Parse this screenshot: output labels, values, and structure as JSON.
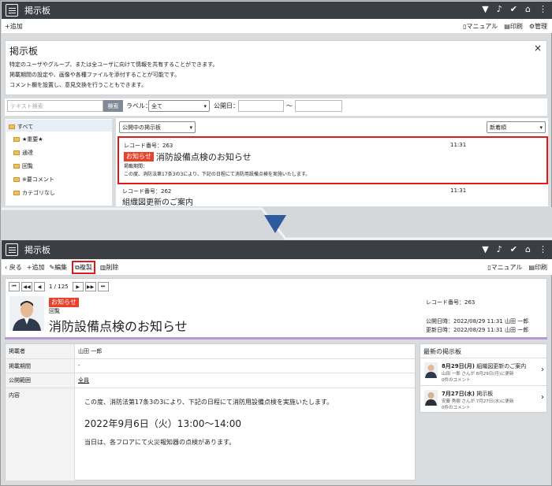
{
  "top": {
    "title": "掲示板",
    "add": "+追加",
    "manual": "マニュアル",
    "print": "印刷",
    "admin": "管理",
    "close": "×",
    "panel_title": "掲示板",
    "desc1": "特定のユーザやグループ、または全ユーザに向けて情報を共有することができます。",
    "desc2": "掲載期間の設定や、画像や各種ファイルを添付することが可能です。",
    "desc3": "コメント欄を設置し、意見交換を行うこともできます。",
    "search_placeholder": "テキスト検索",
    "search_btn": "検索",
    "label_label": "ラベル：",
    "label_value": "全て",
    "pubdate_label": "公開日：",
    "tilde": "～",
    "folders": [
      "すべて",
      "★重要★",
      "通達",
      "回覧",
      "※要コメント",
      "カテゴリなし"
    ],
    "filter": "公開中の掲示板",
    "sort": "新着順",
    "post1": {
      "number": "レコード番号：263",
      "time": "11:31",
      "badge": "お知らせ",
      "title": "消防設備点検のお知らせ",
      "period": "掲載期間：",
      "body": "この度、消防法第17条3の3により、下記の日程にて消防用設備点検を実施いたします。"
    },
    "post2": {
      "number": "レコード番号：262",
      "time": "11:31",
      "title": "組織図更新のご案内"
    }
  },
  "bottom": {
    "title": "掲示板",
    "back": "戻る",
    "add": "+追加",
    "edit": "編集",
    "copy": "複製",
    "delete": "削除",
    "manual": "マニュアル",
    "print": "印刷",
    "pager": "1 / 125",
    "badge": "お知らせ",
    "category": "回覧",
    "post_title": "消防設備点検のお知らせ",
    "record_no": "レコード番号：263",
    "published": "公開日時：2022/08/29 11:31 山田 一郎",
    "updated": "更新日時：2022/08/29 11:31 山田 一郎",
    "fields": [
      {
        "label": "掲載者",
        "value": "山田 一郎"
      },
      {
        "label": "掲載期間",
        "value": "-"
      },
      {
        "label": "公開範囲",
        "value": "全員"
      },
      {
        "label": "内容",
        "value": ""
      }
    ],
    "content1": "この度、消防法第17条3の3により、下記の日程にて消防用設備点検を実施いたします。",
    "content2": "2022年9月6日（火）13:00～14:00",
    "content3": "当日は、各フロアにて火災報知器の点検があります。",
    "latest_title": "最新の掲示板",
    "latest": [
      {
        "date": "8月29日(月)",
        "title": "組織図更新のご案内",
        "meta": "山田 一郎 さんが 8月29日(月)に更新",
        "comments": "0件のコメント"
      },
      {
        "date": "7月27日(水)",
        "title": "掲示板",
        "meta": "安藤 秀樹 さんが 7月27日(水)に更新",
        "comments": "0件のコメント"
      }
    ]
  },
  "colors": {
    "header": "#3b3f45",
    "accent": "#e8412c",
    "arrow": "#2e5b9e",
    "highlight": "#e01a1a"
  }
}
